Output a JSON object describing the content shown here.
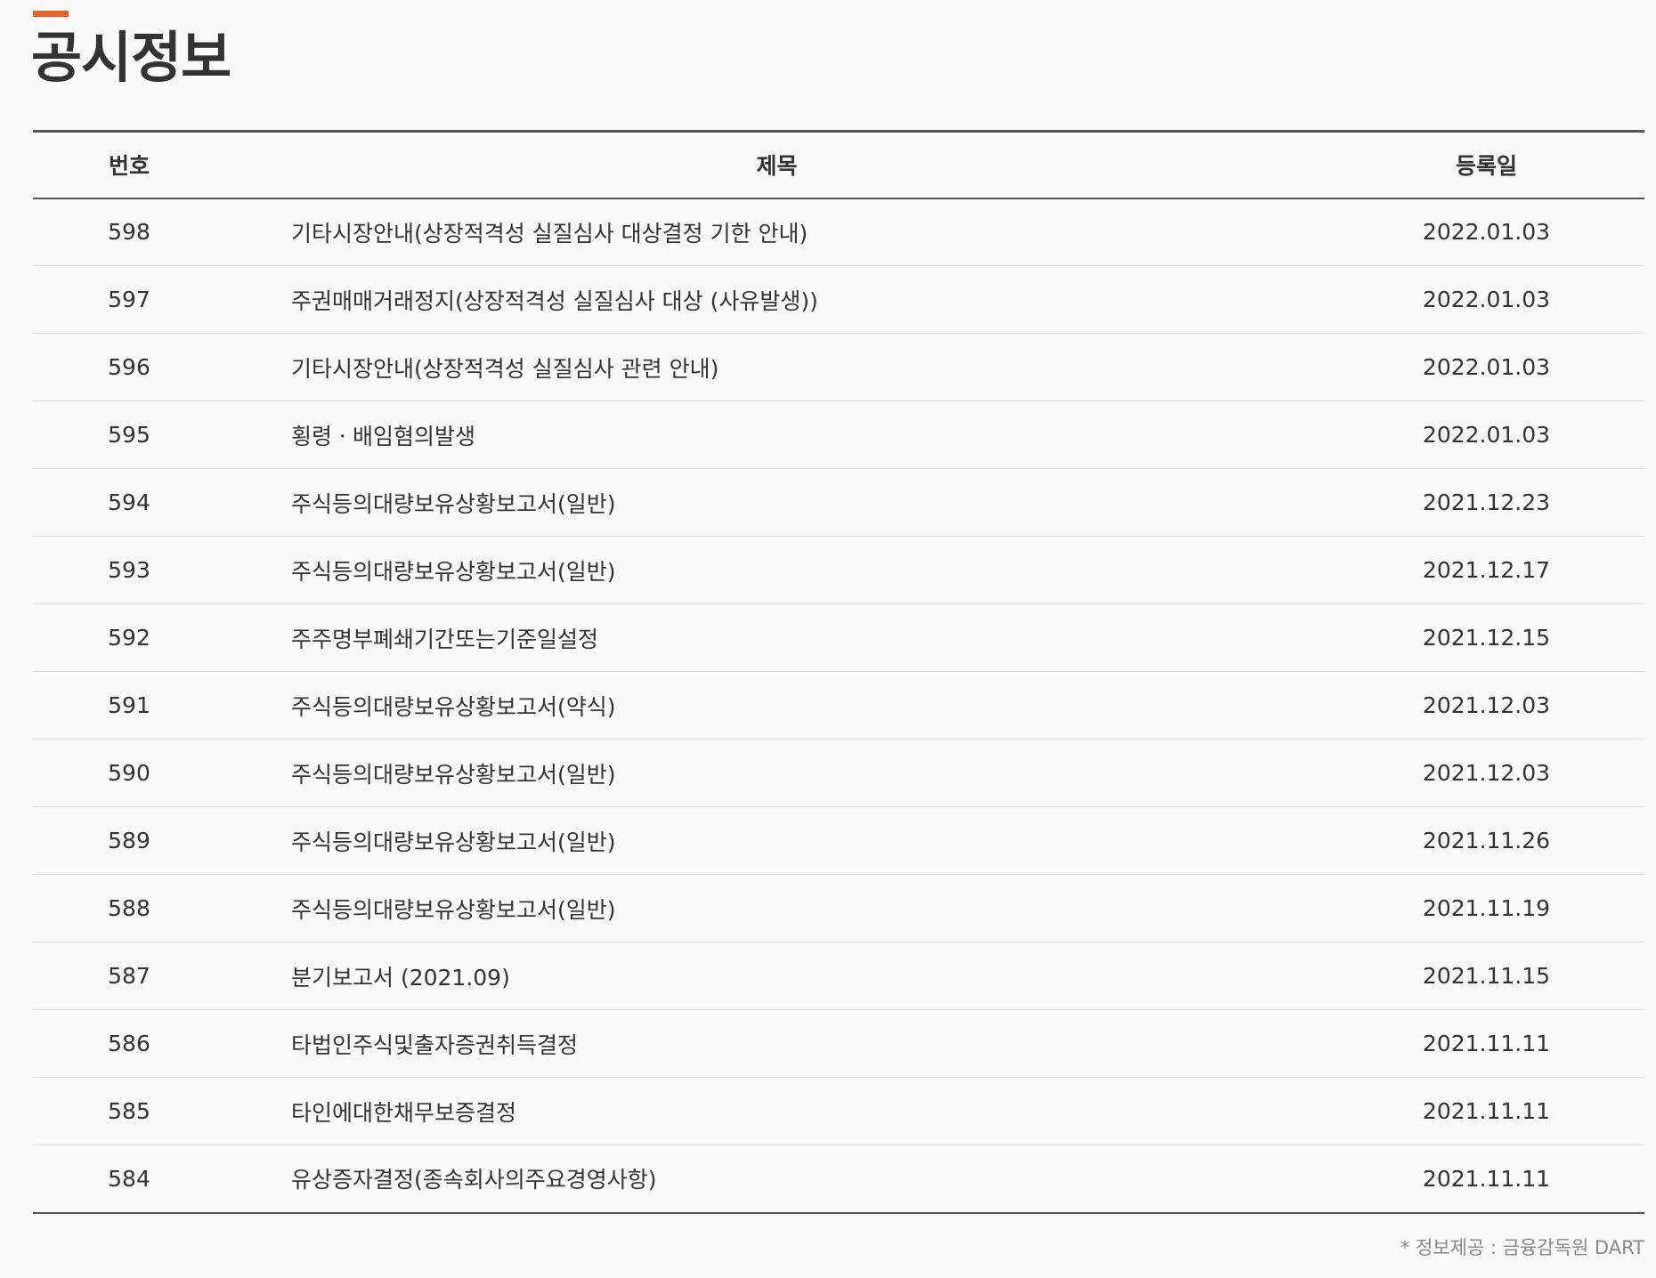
{
  "page": {
    "title": "공시정보",
    "accent_color": "#e8632a"
  },
  "table": {
    "headers": {
      "number": "번호",
      "title": "제목",
      "date": "등록일"
    },
    "rows": [
      {
        "number": "598",
        "title": "기타시장안내(상장적격성 실질심사 대상결정 기한 안내)",
        "date": "2022.01.03"
      },
      {
        "number": "597",
        "title": "주권매매거래정지(상장적격성 실질심사 대상 (사유발생))",
        "date": "2022.01.03"
      },
      {
        "number": "596",
        "title": "기타시장안내(상장적격성 실질심사 관련 안내)",
        "date": "2022.01.03"
      },
      {
        "number": "595",
        "title": "횡령ㆍ배임혐의발생",
        "date": "2022.01.03"
      },
      {
        "number": "594",
        "title": "주식등의대량보유상황보고서(일반)",
        "date": "2021.12.23"
      },
      {
        "number": "593",
        "title": "주식등의대량보유상황보고서(일반)",
        "date": "2021.12.17"
      },
      {
        "number": "592",
        "title": "주주명부폐쇄기간또는기준일설정",
        "date": "2021.12.15"
      },
      {
        "number": "591",
        "title": "주식등의대량보유상황보고서(약식)",
        "date": "2021.12.03"
      },
      {
        "number": "590",
        "title": "주식등의대량보유상황보고서(일반)",
        "date": "2021.12.03"
      },
      {
        "number": "589",
        "title": "주식등의대량보유상황보고서(일반)",
        "date": "2021.11.26"
      },
      {
        "number": "588",
        "title": "주식등의대량보유상황보고서(일반)",
        "date": "2021.11.19"
      },
      {
        "number": "587",
        "title": "분기보고서 (2021.09)",
        "date": "2021.11.15"
      },
      {
        "number": "586",
        "title": "타법인주식및출자증권취득결정",
        "date": "2021.11.11"
      },
      {
        "number": "585",
        "title": "타인에대한채무보증결정",
        "date": "2021.11.11"
      },
      {
        "number": "584",
        "title": "유상증자결정(종속회사의주요경영사항)",
        "date": "2021.11.11"
      }
    ]
  },
  "footer": {
    "source_note": "* 정보제공 : 금융감독원 DART"
  }
}
